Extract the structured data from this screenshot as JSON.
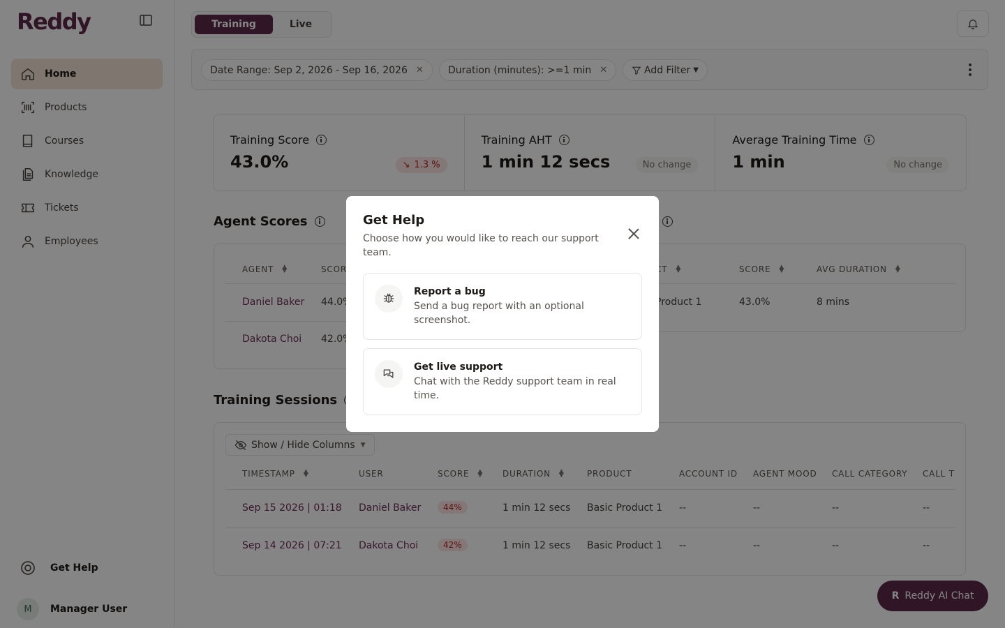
{
  "app": {
    "logo": "Reddy"
  },
  "sidebar": {
    "items": [
      {
        "label": "Home",
        "icon": "home-icon",
        "active": true
      },
      {
        "label": "Products",
        "icon": "barcode-icon"
      },
      {
        "label": "Courses",
        "icon": "book-icon"
      },
      {
        "label": "Knowledge",
        "icon": "document-icon"
      },
      {
        "label": "Tickets",
        "icon": "ticket-icon"
      },
      {
        "label": "Employees",
        "icon": "user-icon"
      }
    ],
    "help_label": "Get Help",
    "user": {
      "initial": "M",
      "name": "Manager User"
    }
  },
  "header": {
    "mode_tabs": [
      "Training",
      "Live"
    ],
    "active_mode": "Training"
  },
  "filters": {
    "chips": [
      "Date Range: Sep 2, 2026 - Sep 16, 2026",
      "Duration (minutes): >=1 min"
    ],
    "add_filter_label": "Add Filter"
  },
  "stats": [
    {
      "label": "Training Score",
      "value": "43.0%",
      "badge": "1.3 %",
      "badge_type": "down"
    },
    {
      "label": "Training AHT",
      "value": "1 min 12 secs",
      "badge": "No change",
      "badge_type": "neutral"
    },
    {
      "label": "Average Training Time",
      "value": "1 min",
      "badge": "No change",
      "badge_type": "neutral"
    }
  ],
  "agent_scores": {
    "title": "Agent Scores",
    "headers": [
      "AGENT",
      "SCOR"
    ],
    "rows": [
      {
        "agent": "Daniel Baker",
        "score": "44.0%"
      },
      {
        "agent": "Dakota Choi",
        "score": "42.0%"
      }
    ]
  },
  "product_scores": {
    "title_fragment": "s",
    "headers": [
      "CT",
      "SCORE",
      "AVG DURATION"
    ],
    "rows": [
      {
        "product": "Product 1",
        "score": "43.0%",
        "avg_duration": "8 mins"
      }
    ]
  },
  "training_sessions": {
    "title": "Training Sessions",
    "columns_button": "Show / Hide Columns",
    "headers": [
      "TIMESTAMP",
      "USER",
      "SCORE",
      "DURATION",
      "PRODUCT",
      "ACCOUNT ID",
      "AGENT MOOD",
      "CALL CATEGORY",
      "CALL T"
    ],
    "rows": [
      {
        "timestamp": "Sep 15 2026 | 01:18",
        "user": "Daniel Baker",
        "score": "44%",
        "duration": "1 min 12 secs",
        "product": "Basic Product 1",
        "account_id": "--",
        "agent_mood": "--",
        "call_category": "--",
        "call_t": "--"
      },
      {
        "timestamp": "Sep 14 2026 | 07:21",
        "user": "Dakota Choi",
        "score": "42%",
        "duration": "1 min 12 secs",
        "product": "Basic Product 1",
        "account_id": "--",
        "agent_mood": "--",
        "call_category": "--",
        "call_t": "--"
      }
    ]
  },
  "ai_chat": {
    "letter": "R",
    "label": "Reddy AI Chat"
  },
  "modal": {
    "title": "Get Help",
    "subtitle": "Choose how you would like to reach our support team.",
    "options": [
      {
        "title": "Report a bug",
        "desc": "Send a bug report with an optional screenshot.",
        "icon": "bug-icon"
      },
      {
        "title": "Get live support",
        "desc": "Chat with the Reddy support team in real time.",
        "icon": "chat-icon"
      }
    ]
  },
  "colors": {
    "brand": "#5b2a48",
    "active_nav": "#f5e3d6",
    "link": "#6b2c55",
    "down_badge": "#fbe4e4"
  }
}
